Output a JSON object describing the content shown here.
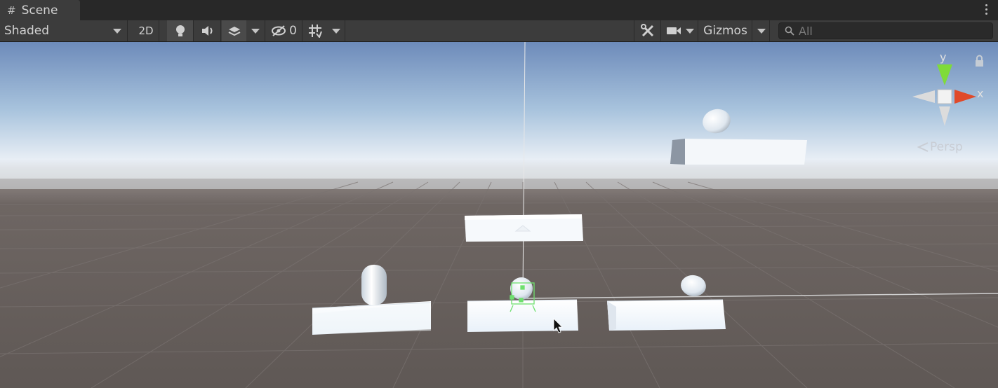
{
  "window": {
    "tab_icon": "hash-icon",
    "tab_label": "Scene",
    "more_icon": "kebab-menu-icon"
  },
  "toolbar": {
    "draw_mode": "Shaded",
    "mode_2d": "2D",
    "lighting_icon": "lightbulb-icon",
    "audio_icon": "speaker-icon",
    "effects_icon": "layers-icon",
    "hidden_icon": "eye-slash-icon",
    "hidden_count": "0",
    "grid_icon": "grid-snap-icon",
    "tools_icon": "tools-icon",
    "camera_icon": "camera-icon",
    "gizmos_label": "Gizmos",
    "search_icon": "search-icon",
    "search_placeholder": "All"
  },
  "scene": {
    "gizmo_axis_y": "y",
    "gizmo_axis_x": "x",
    "projection_label": "Persp",
    "lock_icon": "lock-icon",
    "colors": {
      "sky_top": "#6f8dbb",
      "horizon": "#e8eef5",
      "ground": "#665f5c",
      "axis_y": "#7fdb3a",
      "axis_x": "#e04a2a",
      "selection": "#6ee06e"
    }
  }
}
